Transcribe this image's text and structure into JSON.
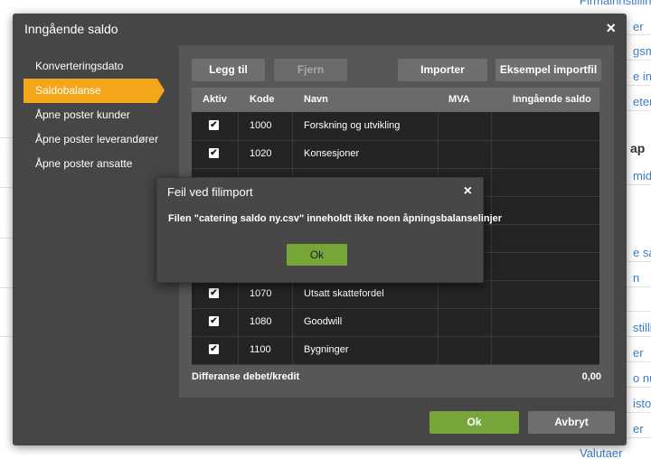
{
  "background": {
    "right_links": [
      "Firmainnstilling",
      "er",
      "gsma",
      "e inns",
      "eter",
      "ap",
      "midde",
      "e sal",
      "n",
      "stilling",
      "er",
      "o num",
      "istori",
      "er",
      "Valutaer"
    ]
  },
  "dialog": {
    "title": "Inngående saldo",
    "close_label": "×",
    "nav": [
      {
        "label": "Konverteringsdato",
        "active": false
      },
      {
        "label": "Saldobalanse",
        "active": true
      },
      {
        "label": "Åpne poster kunder",
        "active": false
      },
      {
        "label": "Åpne poster leverandører",
        "active": false
      },
      {
        "label": "Åpne poster ansatte",
        "active": false
      }
    ],
    "toolbar": {
      "add_label": "Legg til",
      "remove_label": "Fjern",
      "import_label": "Importer",
      "example_label": "Eksempel importfil"
    },
    "table": {
      "columns": [
        "Aktiv",
        "Kode",
        "Navn",
        "MVA",
        "Inngående saldo"
      ],
      "rows": [
        {
          "active": "✔",
          "code": "1000",
          "name": "Forskning og utvikling",
          "vat": "",
          "balance": ""
        },
        {
          "active": "✔",
          "code": "1020",
          "name": "Konsesjoner",
          "vat": "",
          "balance": ""
        },
        {
          "active": "",
          "code": "",
          "name": "",
          "vat": "",
          "balance": ""
        },
        {
          "active": "",
          "code": "",
          "name": "",
          "vat": "",
          "balance": ""
        },
        {
          "active": "",
          "code": "",
          "name": "",
          "vat": "",
          "balance": ""
        },
        {
          "active": "",
          "code": "",
          "name": "",
          "vat": "",
          "balance": ""
        },
        {
          "active": "✔",
          "code": "1070",
          "name": "Utsatt skattefordel",
          "vat": "",
          "balance": ""
        },
        {
          "active": "✔",
          "code": "1080",
          "name": "Goodwill",
          "vat": "",
          "balance": ""
        },
        {
          "active": "✔",
          "code": "1100",
          "name": "Bygninger",
          "vat": "",
          "balance": ""
        }
      ]
    },
    "footer": {
      "diff_label": "Differanse debet/kredit",
      "diff_value": "0,00"
    },
    "ok_label": "Ok",
    "cancel_label": "Avbryt"
  },
  "error_modal": {
    "title": "Feil ved filimport",
    "close_label": "×",
    "message": "Filen \"catering saldo ny.csv\" inneholdt ikke noen åpningsbalanselinjer",
    "ok_label": "Ok"
  },
  "colors": {
    "accent": "#f3a61a",
    "ok_green": "#77a53a",
    "link": "#3b7dc4"
  }
}
